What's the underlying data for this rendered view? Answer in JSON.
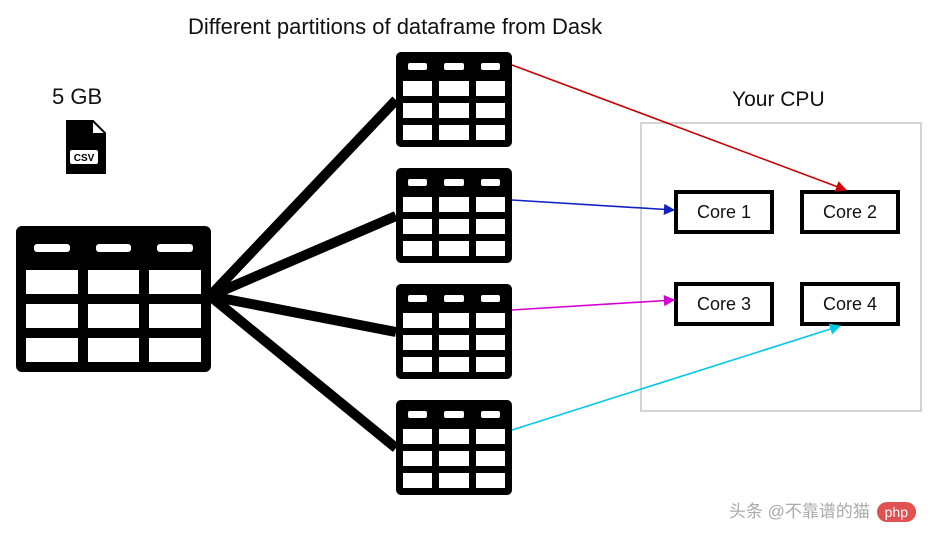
{
  "title": "Different partitions of dataframe from Dask",
  "file_size_label": "5 GB",
  "file_badge": "CSV",
  "cpu_label": "Your CPU",
  "cores": [
    "Core 1",
    "Core 2",
    "Core 3",
    "Core 4"
  ],
  "partitions": 4,
  "arrow_colors": {
    "p1_to_core2": "#cc0000",
    "p2_to_core1": "#1023c2",
    "p3_to_core3": "#d400d4",
    "p4_to_core4": "#00c8e8"
  },
  "watermark": {
    "prefix": "头条 @不靠谱的猫",
    "badge": "php"
  },
  "chart_data": {
    "type": "diagram",
    "title": "Different partitions of dataframe from Dask",
    "description": "A 5 GB CSV becomes one large dataframe which is split into 4 partitions, each dispatched to a distinct CPU core.",
    "source": {
      "size_gb": 5,
      "format": "CSV"
    },
    "mapping": [
      {
        "partition": 1,
        "core": "Core 2",
        "color": "#cc0000"
      },
      {
        "partition": 2,
        "core": "Core 1",
        "color": "#1023c2"
      },
      {
        "partition": 3,
        "core": "Core 3",
        "color": "#d400d4"
      },
      {
        "partition": 4,
        "core": "Core 4",
        "color": "#00c8e8"
      }
    ],
    "cpu_cores": 4
  }
}
